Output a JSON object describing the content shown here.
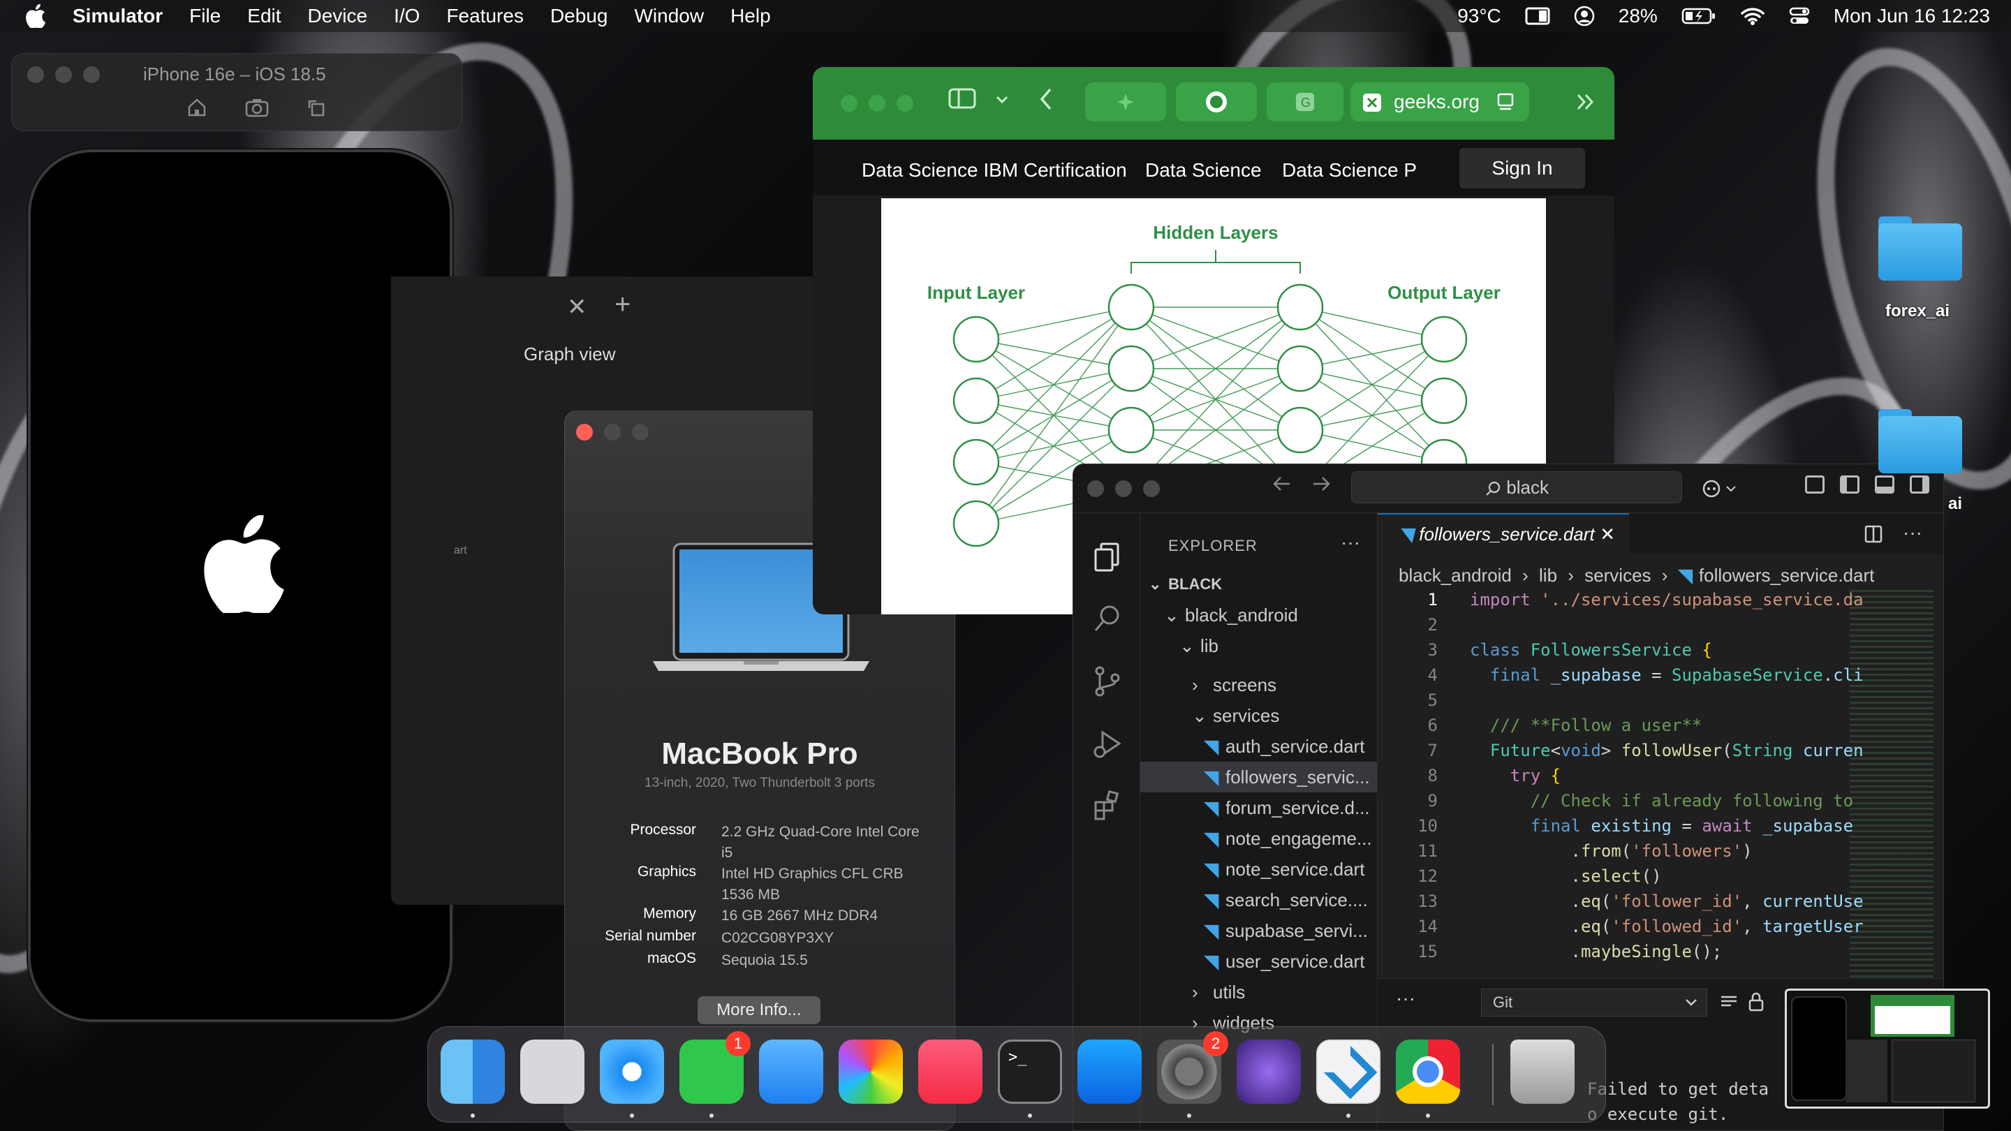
{
  "menubar": {
    "app": "Simulator",
    "items": [
      "File",
      "Edit",
      "Device",
      "I/O",
      "Features",
      "Debug",
      "Window",
      "Help"
    ],
    "temperature": "93°C",
    "battery": "28%",
    "datetime": "Mon Jun 16  12:23"
  },
  "simulator": {
    "title": "iPhone 16e – iOS 18.5"
  },
  "obsidian": {
    "tab_close": "✕",
    "tab_add": "+",
    "graph_label": "Graph view",
    "fragment": "art"
  },
  "about": {
    "title": "MacBook Pro",
    "subtitle": "13-inch, 2020, Two Thunderbolt 3 ports",
    "specs": [
      {
        "key": "Processor",
        "value": "2.2 GHz Quad-Core Intel Core i5"
      },
      {
        "key": "Graphics",
        "value": "Intel HD Graphics CFL CRB 1536 MB"
      },
      {
        "key": "Memory",
        "value": "16 GB 2667 MHz DDR4"
      },
      {
        "key": "Serial number",
        "value": "C02CG08YP3XY"
      },
      {
        "key": "macOS",
        "value": "Sequoia 15.5"
      }
    ],
    "more_info": "More Info..."
  },
  "browser": {
    "url": "geeks.org",
    "nav": [
      "Data Science IBM Certification",
      "Data Science",
      "Data Science P"
    ],
    "sign_in": "Sign In",
    "diagram": {
      "hidden": "Hidden Layers",
      "input": "Input Layer",
      "output": "Output Layer"
    }
  },
  "vscode": {
    "search": "black",
    "explorer_title": "EXPLORER",
    "root": "BLACK",
    "tree": [
      {
        "label": "black_android",
        "type": "folder-open",
        "depth": 1
      },
      {
        "label": "lib",
        "type": "folder-open",
        "depth": 2
      },
      {
        "label": "screens",
        "type": "folder",
        "depth": 3
      },
      {
        "label": "services",
        "type": "folder-open",
        "depth": 3
      },
      {
        "label": "auth_service.dart",
        "type": "file",
        "depth": 4
      },
      {
        "label": "followers_servic...",
        "type": "file",
        "depth": 4,
        "selected": true
      },
      {
        "label": "forum_service.d...",
        "type": "file",
        "depth": 4
      },
      {
        "label": "note_engageme...",
        "type": "file",
        "depth": 4
      },
      {
        "label": "note_service.dart",
        "type": "file",
        "depth": 4
      },
      {
        "label": "search_service....",
        "type": "file",
        "depth": 4
      },
      {
        "label": "supabase_servi...",
        "type": "file",
        "depth": 4
      },
      {
        "label": "user_service.dart",
        "type": "file",
        "depth": 4
      },
      {
        "label": "utils",
        "type": "folder",
        "depth": 3
      },
      {
        "label": "widgets",
        "type": "folder",
        "depth": 3
      }
    ],
    "tab": "followers_service.dart",
    "breadcrumbs": [
      "black_android",
      "lib",
      "services",
      "followers_service.dart"
    ],
    "git_select": "Git",
    "terminal": [
      "Failed to get deta",
      "o execute git."
    ]
  },
  "desktop": {
    "folders": [
      "forex_ai",
      "ai"
    ]
  },
  "dock": {
    "apps": [
      {
        "name": "Finder"
      },
      {
        "name": "Launchpad"
      },
      {
        "name": "Safari"
      },
      {
        "name": "Messages",
        "badge": "1"
      },
      {
        "name": "Mail"
      },
      {
        "name": "Photos"
      },
      {
        "name": "Music"
      },
      {
        "name": "Terminal"
      },
      {
        "name": "Xcode"
      },
      {
        "name": "System Settings",
        "badge": "2"
      },
      {
        "name": "Obsidian"
      },
      {
        "name": "Visual Studio Code"
      },
      {
        "name": "Chrome"
      },
      {
        "name": "Trash"
      }
    ]
  }
}
